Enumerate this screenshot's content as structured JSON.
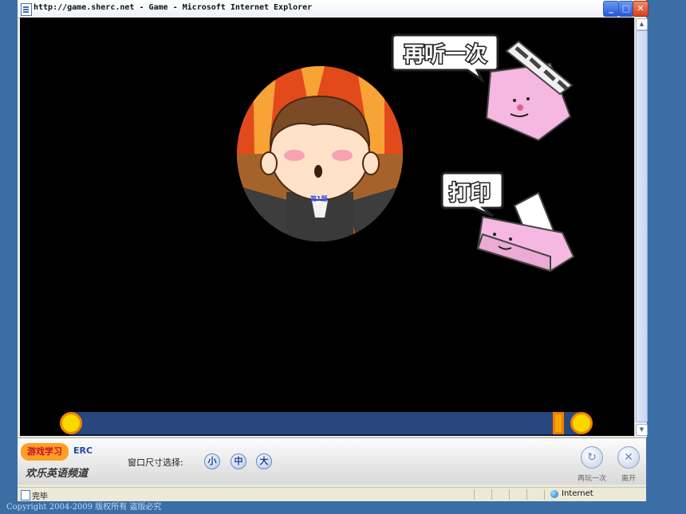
{
  "window": {
    "title": "http://game.sherc.net - Game - Microsoft Internet Explorer"
  },
  "game": {
    "replay_bubble": "再听一次",
    "print_bubble": "打印",
    "character_badge": "第1题"
  },
  "bottom_bar": {
    "brand_badge": "游戏学习",
    "brand_logo": "ERC",
    "brand_tagline": "欢乐英语频道",
    "size_label": "窗口尺寸选择:",
    "size_options": [
      "小",
      "中",
      "大"
    ],
    "replay_label": "再玩一次",
    "exit_label": "离开"
  },
  "statusbar": {
    "status": "完毕",
    "zone": "Internet"
  },
  "footer": {
    "copyright": "Copyright 2004-2009 版权所有 盗版必究"
  },
  "progress": {
    "value": 0
  },
  "colors": {
    "desktop": "#3a6ea5",
    "game_background": "#000000",
    "progress_track": "#2a467f",
    "knob_fill": "#f9d800",
    "knob_border": "#f08400",
    "speech_bubble": "#ffffff",
    "props_pink": "#f5b8e0"
  },
  "icons": [
    "ie-page-icon",
    "minimize-icon",
    "maximize-icon",
    "close-icon",
    "clapperboard-icon",
    "printer-icon",
    "replay-icon",
    "exit-icon",
    "internet-zone-icon"
  ]
}
